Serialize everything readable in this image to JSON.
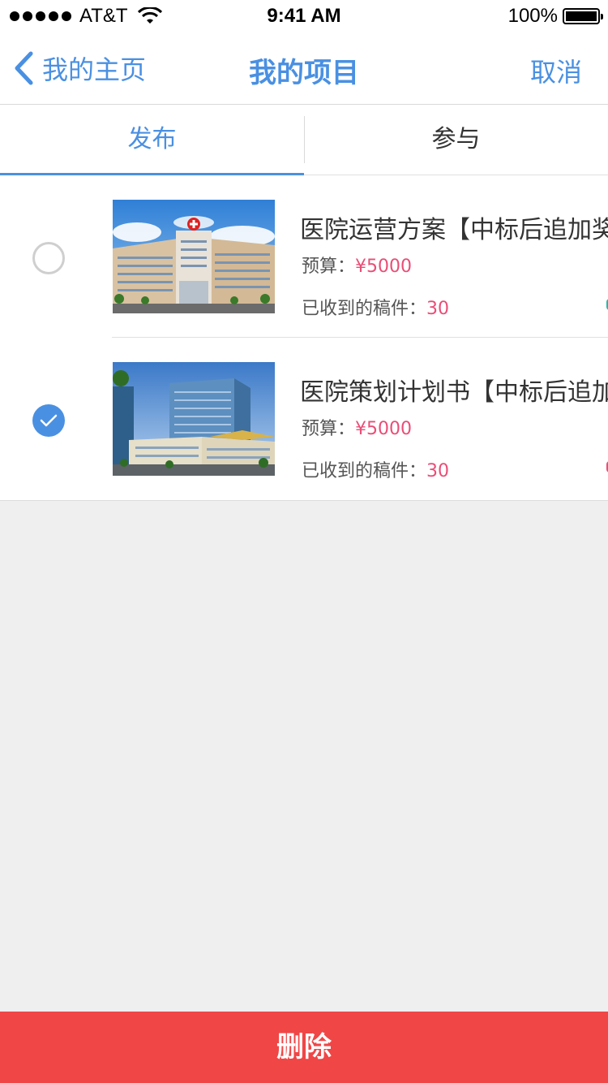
{
  "status_bar": {
    "carrier": "AT&T",
    "time": "9:41 AM",
    "battery": "100%"
  },
  "nav": {
    "back_label": "我的主页",
    "title": "我的项目",
    "cancel_label": "取消"
  },
  "tabs": [
    {
      "label": "发布",
      "active": true
    },
    {
      "label": "参与",
      "active": false
    }
  ],
  "items": [
    {
      "title": "医院运营方案【中标后追加奖",
      "budget_label": "预算：",
      "budget_value": "¥5000",
      "received_label": "已收到的稿件：",
      "received_value": "30",
      "selected": false
    },
    {
      "title": "医院策划计划书【中标后追加",
      "budget_label": "预算：",
      "budget_value": "¥5000",
      "received_label": "已收到的稿件：",
      "received_value": "30",
      "selected": true
    }
  ],
  "footer": {
    "delete_label": "删除"
  },
  "colors": {
    "accent": "#4a90e2",
    "price": "#e94e77",
    "delete": "#f04646",
    "background": "#efefef"
  }
}
